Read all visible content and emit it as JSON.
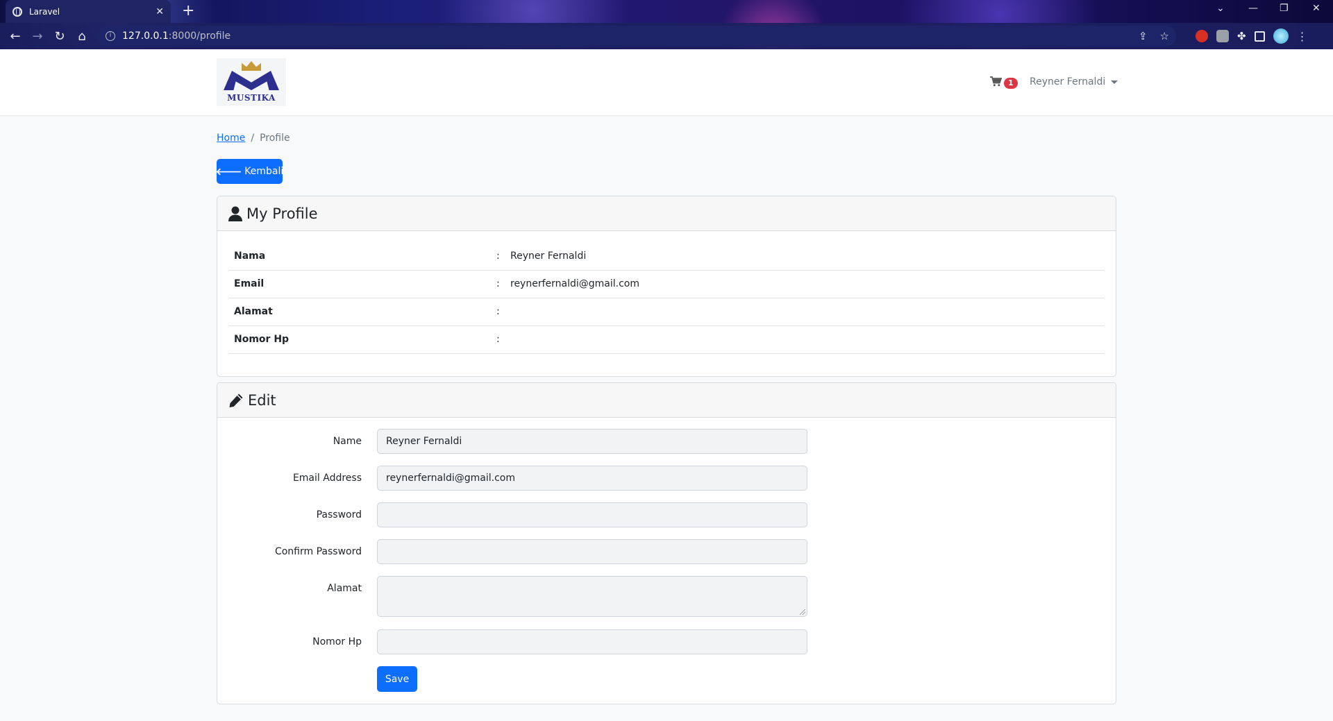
{
  "browser": {
    "tab_title": "Laravel",
    "url_host": "127.0.0.1",
    "url_path": ":8000/profile"
  },
  "navbar": {
    "logo_text": "MUSTIKA",
    "cart_count": "1",
    "user_name": "Reyner Fernaldi"
  },
  "breadcrumb": {
    "home": "Home",
    "current": "Profile"
  },
  "back_button": "Kembali",
  "profile": {
    "title": "My Profile",
    "rows": [
      {
        "label": "Nama",
        "sep": ":",
        "value": "Reyner Fernaldi"
      },
      {
        "label": "Email",
        "sep": ":",
        "value": "reynerfernaldi@gmail.com"
      },
      {
        "label": "Alamat",
        "sep": ":",
        "value": ""
      },
      {
        "label": "Nomor Hp",
        "sep": ":",
        "value": ""
      }
    ]
  },
  "edit": {
    "title": "Edit",
    "fields": {
      "name_label": "Name",
      "name_value": "Reyner Fernaldi",
      "email_label": "Email Address",
      "email_value": "reynerfernaldi@gmail.com",
      "password_label": "Password",
      "confirm_label": "Confirm Password",
      "alamat_label": "Alamat",
      "nomor_label": "Nomor Hp"
    },
    "save_label": "Save"
  },
  "colors": {
    "primary": "#0d6efd",
    "badge": "#dc3545"
  }
}
